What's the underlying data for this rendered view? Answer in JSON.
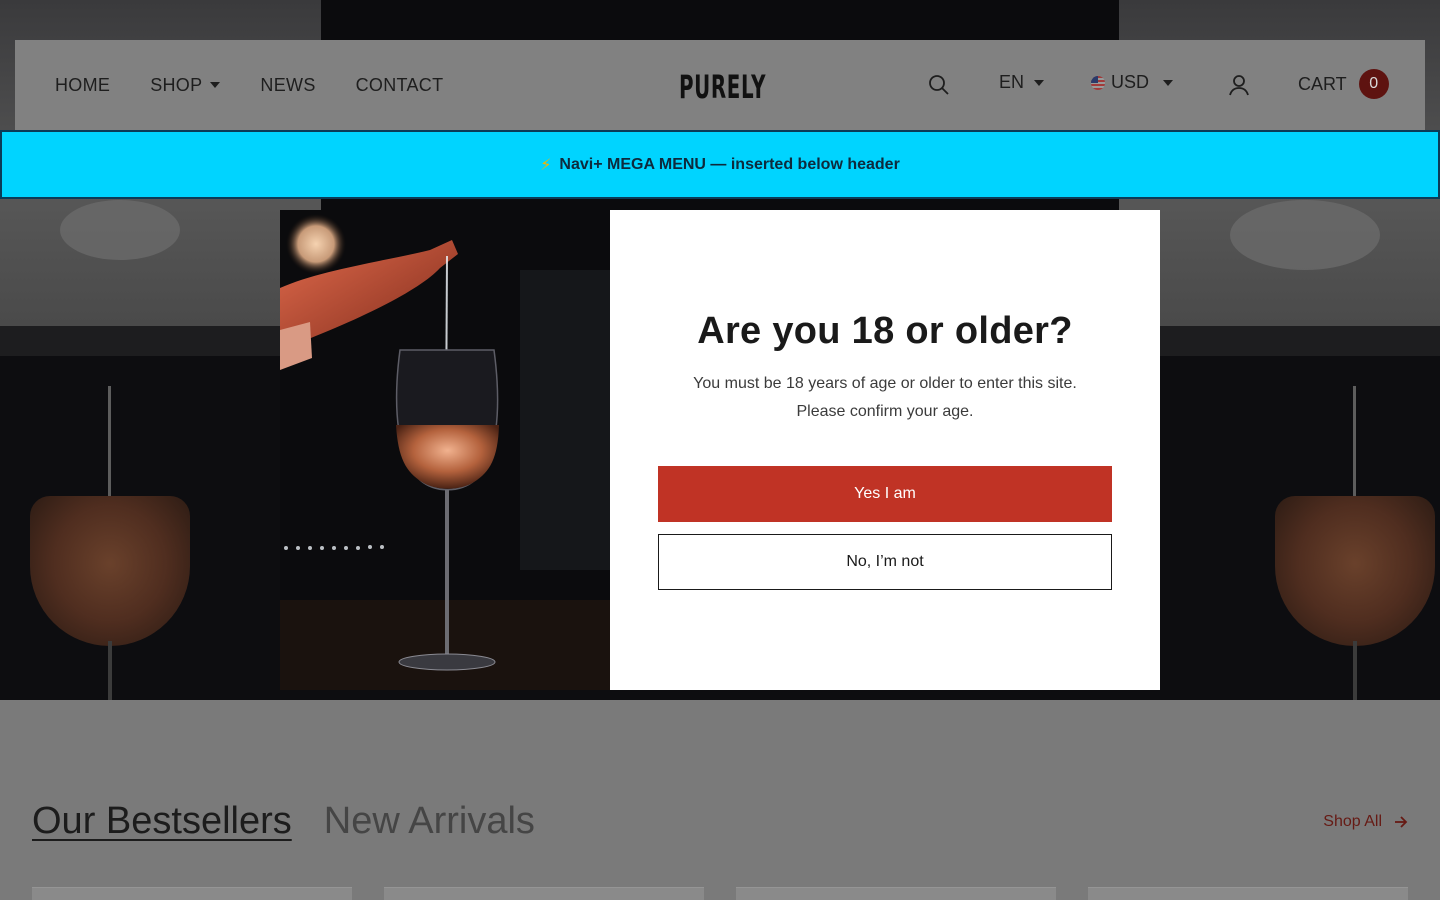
{
  "header": {
    "nav": [
      {
        "label": "HOME",
        "has_dropdown": false
      },
      {
        "label": "SHOP",
        "has_dropdown": true
      },
      {
        "label": "NEWS",
        "has_dropdown": false
      },
      {
        "label": "CONTACT",
        "has_dropdown": false
      }
    ],
    "logo": "PURELY",
    "search_icon": "search-icon",
    "language": "EN",
    "currency": "USD",
    "account_icon": "user-icon",
    "cart_label": "CART",
    "cart_count": "0"
  },
  "banner": {
    "icon": "⚡",
    "text": "Navi+ MEGA MENU — inserted below header",
    "color": "#00d4ff"
  },
  "modal": {
    "title": "Are you 18 or older?",
    "line1": "You must be 18 years of age or older to enter this site.",
    "line2": "Please confirm your age.",
    "yes_label": "Yes I am",
    "no_label": "No, I’m not",
    "accent": "#c03325"
  },
  "collections": {
    "tabs": [
      {
        "label": "Our Bestsellers",
        "active": true
      },
      {
        "label": "New Arrivals",
        "active": false
      }
    ],
    "shop_all": "Shop All"
  }
}
